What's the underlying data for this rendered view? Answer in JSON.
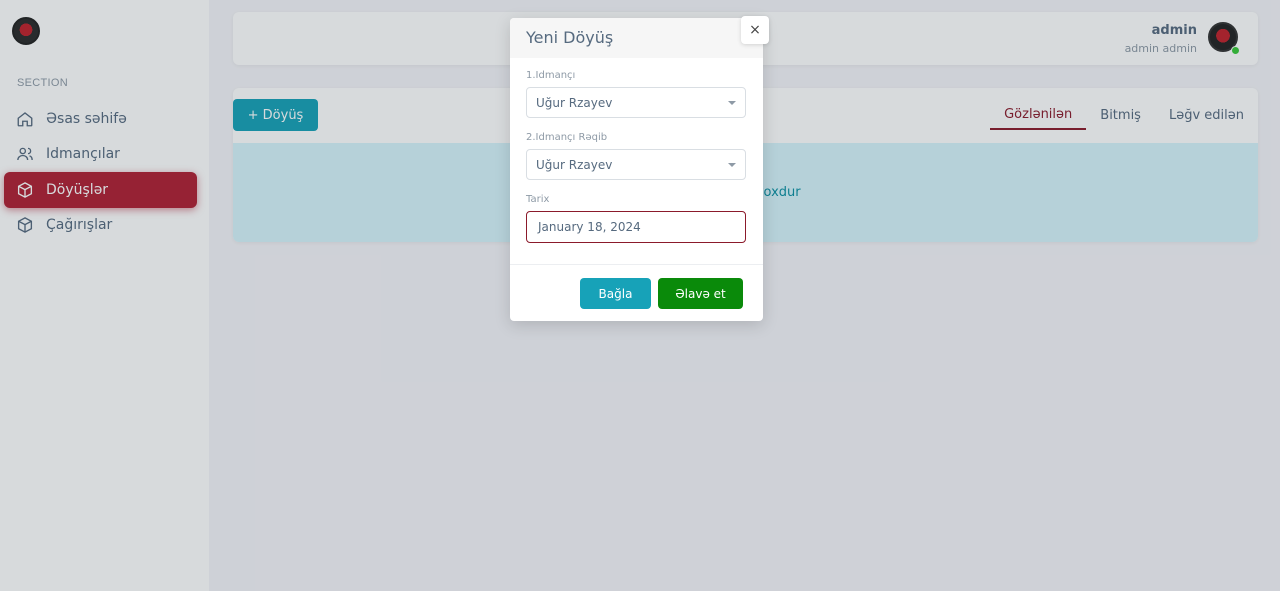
{
  "sidebar": {
    "section_title": "SECTION",
    "items": [
      {
        "label": "Əsas səhifə",
        "icon": "home-icon"
      },
      {
        "label": "Idmançılar",
        "icon": "users-icon"
      },
      {
        "label": "Döyüşlər",
        "icon": "cube-icon",
        "active": true
      },
      {
        "label": "Çağırışlar",
        "icon": "cube-icon"
      }
    ]
  },
  "navbar": {
    "user_name": "admin",
    "user_role": "admin admin"
  },
  "main": {
    "add_button_label": "+ Döyüş",
    "tabs": [
      {
        "label": "Gözlənilən",
        "active": true
      },
      {
        "label": "Bitmiş"
      },
      {
        "label": "Ləğv edilən"
      }
    ],
    "empty_message_visible": "yüş yoxdur"
  },
  "modal": {
    "title": "Yeni Döyüş",
    "close_symbol": "×",
    "fields": {
      "fighter1_label": "1.Idmançı",
      "fighter1_value": "Uğur Rzayev",
      "fighter2_label": "2.Idmançı Rəqib",
      "fighter2_value": "Uğur Rzayev",
      "date_label": "Tarix",
      "date_value": "January 18, 2024"
    },
    "cancel_label": "Bağla",
    "submit_label": "Əlavə et"
  },
  "colors": {
    "accent": "#8b1a2b",
    "info": "#17a2b8",
    "success": "#0a8a0a"
  }
}
